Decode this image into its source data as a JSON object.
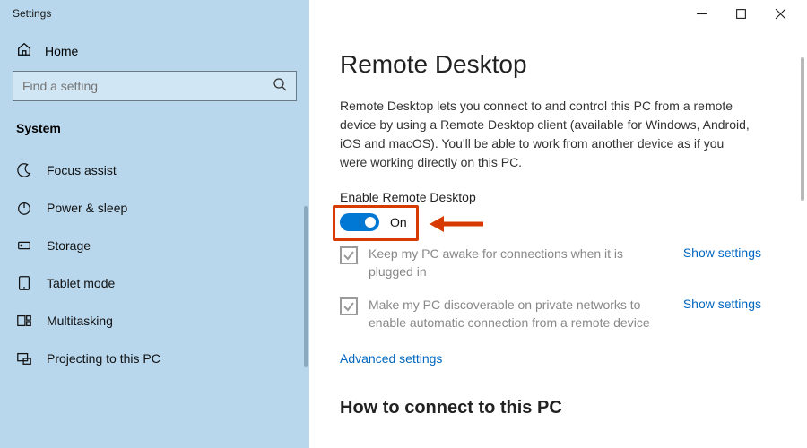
{
  "titlebar": {
    "title": "Settings"
  },
  "sidebar": {
    "home_label": "Home",
    "search_placeholder": "Find a setting",
    "section_label": "System",
    "items": [
      {
        "label": "Focus assist",
        "icon": "moon"
      },
      {
        "label": "Power & sleep",
        "icon": "power"
      },
      {
        "label": "Storage",
        "icon": "storage"
      },
      {
        "label": "Tablet mode",
        "icon": "tablet"
      },
      {
        "label": "Multitasking",
        "icon": "multitasking"
      },
      {
        "label": "Projecting to this PC",
        "icon": "projecting"
      }
    ]
  },
  "main": {
    "title": "Remote Desktop",
    "description": "Remote Desktop lets you connect to and control this PC from a remote device by using a Remote Desktop client (available for Windows, Android, iOS and macOS). You'll be able to work from another device as if you were working directly on this PC.",
    "enable_label": "Enable Remote Desktop",
    "toggle_state": "On",
    "options": [
      {
        "text": "Keep my PC awake for connections when it is plugged in",
        "link": "Show settings"
      },
      {
        "text": "Make my PC discoverable on private networks to enable automatic connection from a remote device",
        "link": "Show settings"
      }
    ],
    "advanced_link": "Advanced settings",
    "connect_title": "How to connect to this PC"
  }
}
